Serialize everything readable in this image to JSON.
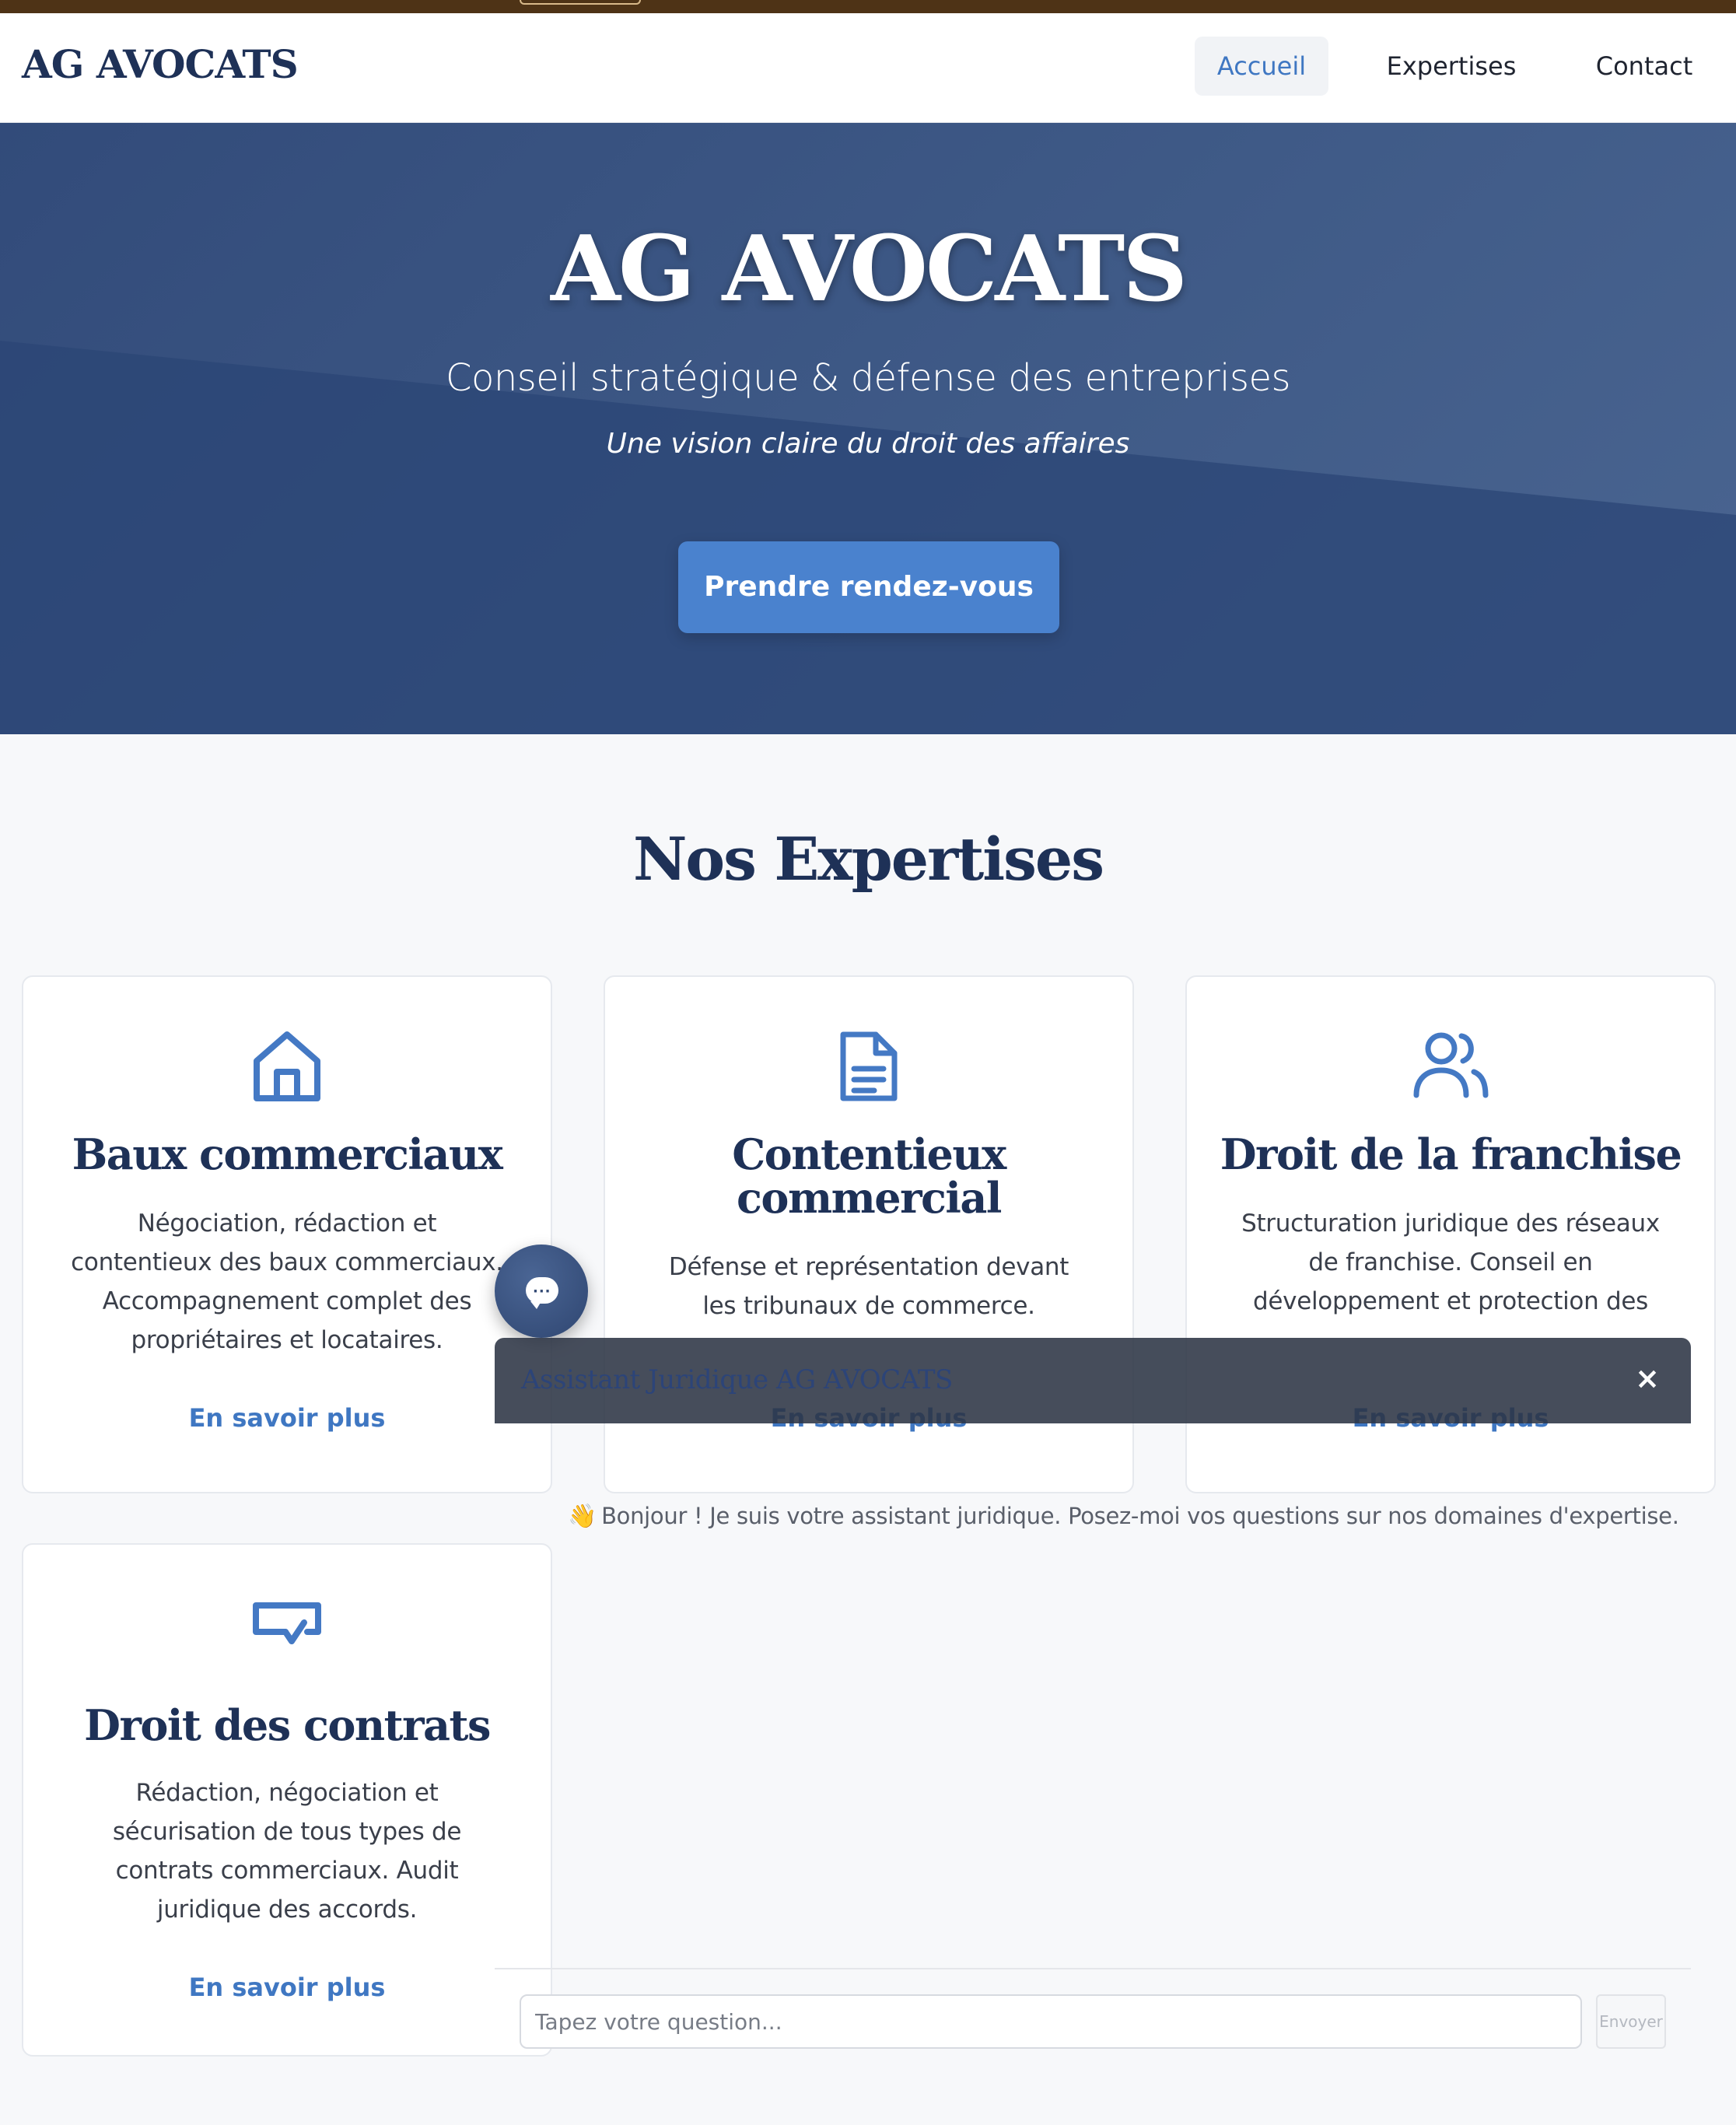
{
  "navbar": {
    "brand": "AG AVOCATS",
    "links": [
      {
        "label": "Accueil",
        "active": true
      },
      {
        "label": "Expertises",
        "active": false
      },
      {
        "label": "Contact",
        "active": false
      }
    ]
  },
  "hero": {
    "title": "AG AVOCATS",
    "subtitle": "Conseil stratégique & défense des entreprises",
    "tagline": "Une vision claire du droit des affaires",
    "cta_label": "Prendre rendez-vous"
  },
  "expertises": {
    "title": "Nos Expertises",
    "cards": [
      {
        "icon": "house-icon",
        "title": "Baux commerciaux",
        "description": "Négociation, rédaction et contentieux des baux commerciaux. Accompagnement complet des propriétaires et locataires.",
        "link": "En savoir plus"
      },
      {
        "icon": "document-icon",
        "title": "Contentieux commercial",
        "description": "Défense et représentation devant les tribunaux de commerce. Résolution des litiges commerciaux et gestion",
        "link": "En savoir plus"
      },
      {
        "icon": "users-icon",
        "title": "Droit de la franchise",
        "description": "Structuration juridique des réseaux de franchise. Conseil en développement et protection des marques.",
        "link": "En savoir plus"
      },
      {
        "icon": "contract-signature-icon",
        "title": "Droit des contrats",
        "description": "Rédaction, négociation et sécurisation de tous types de contrats commerciaux. Audit juridique des accords.",
        "link": "En savoir plus"
      }
    ]
  },
  "chat": {
    "title": "Assistant Juridique AG AVOCATS",
    "close_label": "×",
    "greeting_emoji": "👋",
    "greeting": "Bonjour ! Je suis votre assistant juridique. Posez-moi vos questions sur nos domaines d'expertise.",
    "input_placeholder": "Tapez votre question...",
    "send_label": "Envoyer"
  },
  "colors": {
    "brand_navy": "#1e3157",
    "accent_blue": "#4a82ce",
    "hero_bg": "#3a5483",
    "link_blue": "#3f77c2"
  }
}
